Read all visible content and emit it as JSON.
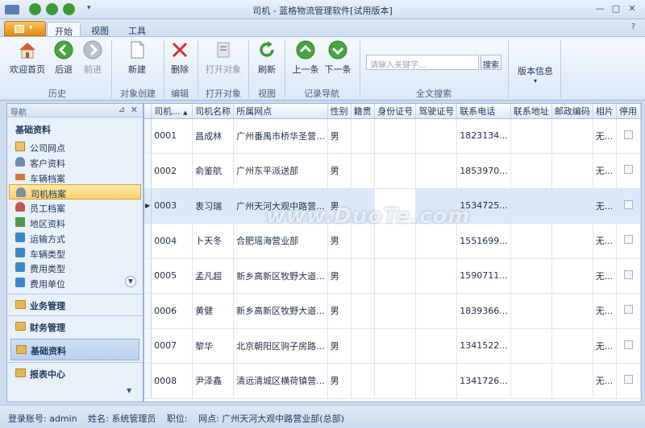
{
  "window": {
    "title": "司机 - 蓝格物流管理软件[试用版本]"
  },
  "ribbon_tabs": [
    {
      "label": "开始",
      "active": true
    },
    {
      "label": "视图",
      "active": false
    },
    {
      "label": "工具",
      "active": false
    }
  ],
  "ribbon": {
    "home_label": "欢迎首页",
    "back_label": "后退",
    "forward_label": "前进",
    "new_label": "新建",
    "delete_label": "删除",
    "open_label": "打开对象",
    "refresh_label": "刷新",
    "prev_label": "上一条",
    "next_label": "下一条",
    "version_label": "版本信息",
    "search_placeholder": "请输入关键字...",
    "search_btn": "搜索",
    "groups": {
      "history": "历史",
      "create": "对象创建",
      "edit": "编辑",
      "open": "打开对象",
      "view": "视图",
      "record_nav": "记录导航",
      "fulltext": "全文搜索"
    }
  },
  "nav": {
    "header": "导航",
    "section_title": "基础资料",
    "items": [
      {
        "label": "公司网点",
        "icon": "house-icon"
      },
      {
        "label": "客户资料",
        "icon": "person-icon"
      },
      {
        "label": "车辆档案",
        "icon": "truck-icon"
      },
      {
        "label": "司机档案",
        "icon": "driver-icon",
        "selected": true
      },
      {
        "label": "员工档案",
        "icon": "employee-icon"
      },
      {
        "label": "地区资料",
        "icon": "region-icon"
      },
      {
        "label": "运输方式",
        "icon": "info-icon"
      },
      {
        "label": "车辆类型",
        "icon": "info-icon"
      },
      {
        "label": "费用类型",
        "icon": "info-icon"
      },
      {
        "label": "费用单位",
        "icon": "info-icon"
      }
    ],
    "modules": [
      {
        "label": "业务管理"
      },
      {
        "label": "财务管理"
      },
      {
        "label": "基础资料",
        "active": true
      },
      {
        "label": "报表中心"
      }
    ]
  },
  "grid": {
    "columns": [
      "司机...",
      "司机名称",
      "所属网点",
      "性别",
      "籍贯",
      "身份证号",
      "驾驶证号",
      "联系电话",
      "联系地址",
      "邮政编码",
      "相片",
      "停用"
    ],
    "rows": [
      [
        "0001",
        "昌成林",
        "广州番禺市桥华圣营...",
        "男",
        "",
        "",
        "",
        "1823134...",
        "",
        "",
        "无...",
        ""
      ],
      [
        "0002",
        "俞鉴航",
        "广州东平派送部",
        "男",
        "",
        "",
        "",
        "1853970...",
        "",
        "",
        "无...",
        ""
      ],
      [
        "0003",
        "衷习瑞",
        "广州天河大观中路营...",
        "男",
        "",
        "",
        "",
        "1534725...",
        "",
        "",
        "无...",
        ""
      ],
      [
        "0004",
        "卜天冬",
        "合肥瑶海营业部",
        "男",
        "",
        "",
        "",
        "1551699...",
        "",
        "",
        "无...",
        ""
      ],
      [
        "0005",
        "孟凡超",
        "新乡高新区牧野大道...",
        "男",
        "",
        "",
        "",
        "1590711...",
        "",
        "",
        "无...",
        ""
      ],
      [
        "0006",
        "黄健",
        "新乡高新区牧野大道...",
        "男",
        "",
        "",
        "",
        "1839366...",
        "",
        "",
        "无...",
        ""
      ],
      [
        "0007",
        "黎华",
        "北京朝阳区驹子房路...",
        "男",
        "",
        "",
        "",
        "1341522...",
        "",
        "",
        "无...",
        ""
      ],
      [
        "0008",
        "尹泽鑫",
        "清远清城区横荷镇营...",
        "男",
        "",
        "",
        "",
        "1341726...",
        "",
        "",
        "无...",
        ""
      ]
    ],
    "current_row": 2
  },
  "status": {
    "account": "登录账号: admin",
    "name": "姓名: 系统管理员",
    "position": "职位:",
    "outlet": "网点: 广州天河大观中路营业部(总部)"
  },
  "watermark": "www.DuoTe.com"
}
